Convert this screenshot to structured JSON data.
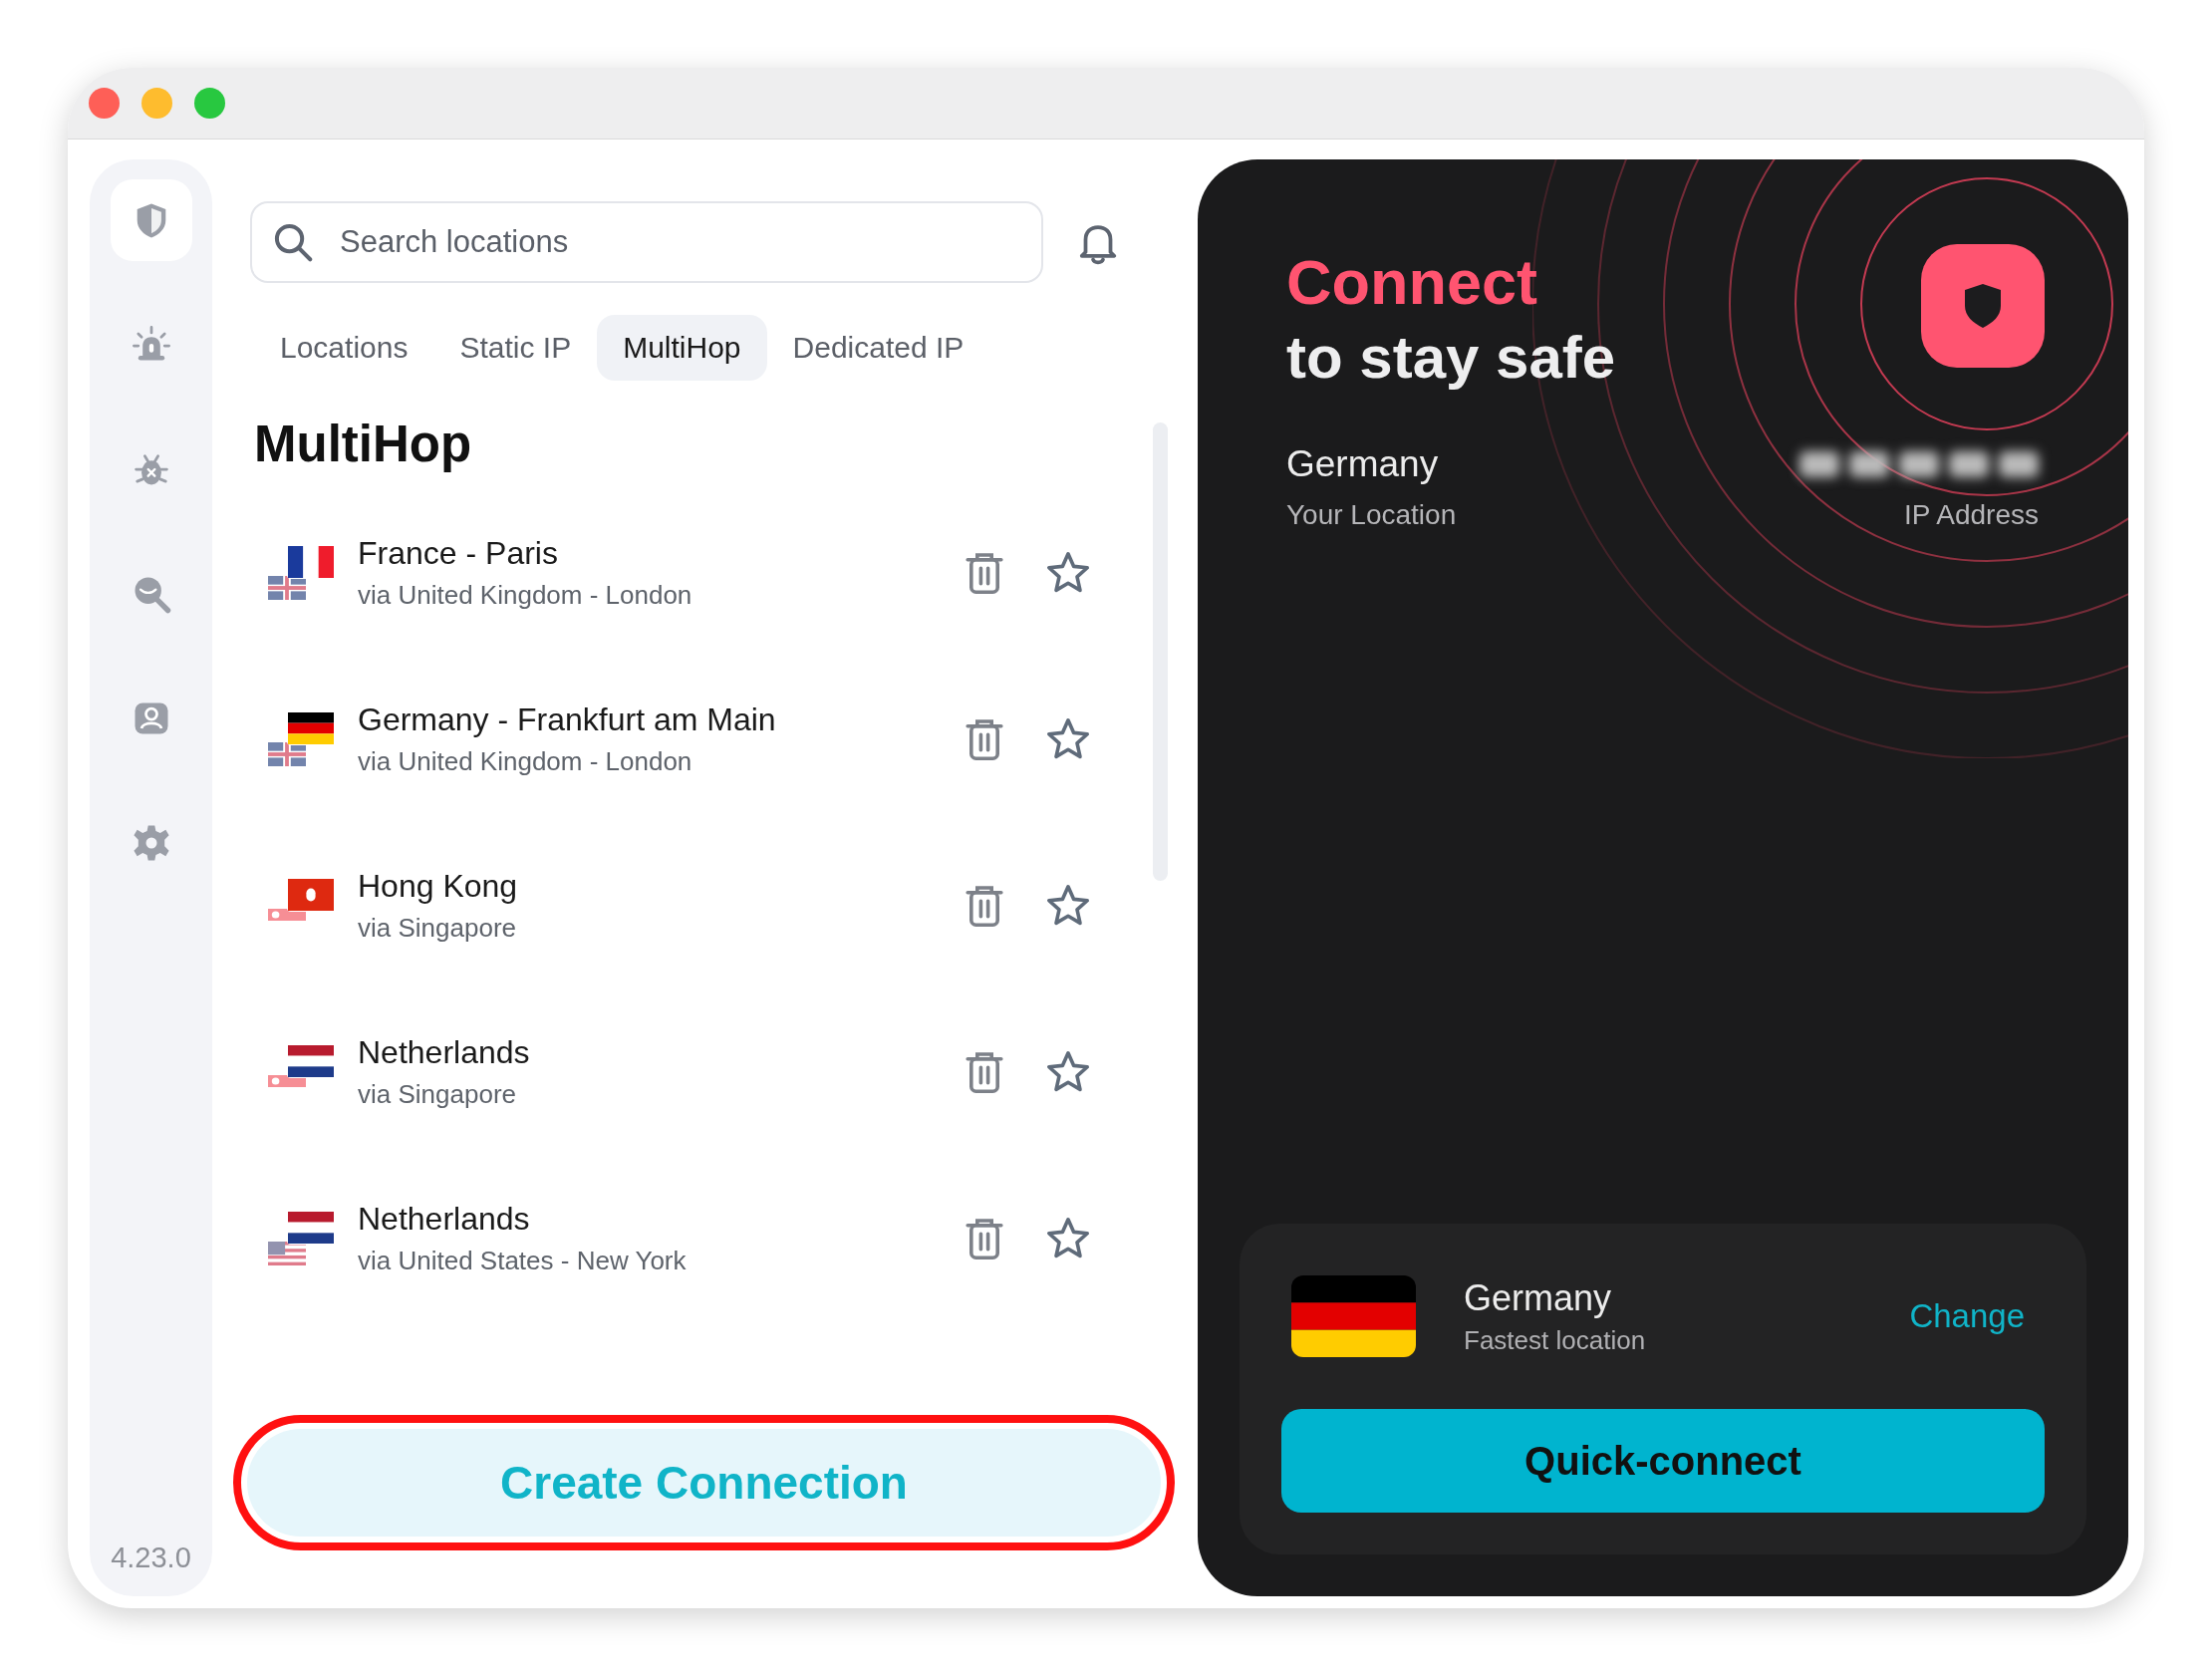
{
  "sidebar": {
    "items": [
      {
        "kind": "shield",
        "selected": true
      },
      {
        "kind": "alarm",
        "selected": false
      },
      {
        "kind": "bug",
        "selected": false
      },
      {
        "kind": "eye-search",
        "selected": false
      },
      {
        "kind": "account",
        "selected": false
      },
      {
        "kind": "settings",
        "selected": false
      }
    ],
    "version": "4.23.0"
  },
  "search": {
    "placeholder": "Search locations"
  },
  "tabs": [
    {
      "label": "Locations",
      "selected": false
    },
    {
      "label": "Static IP",
      "selected": false
    },
    {
      "label": "MultiHop",
      "selected": true
    },
    {
      "label": "Dedicated IP",
      "selected": false
    }
  ],
  "heading": "MultiHop",
  "routes": [
    {
      "name": "France - Paris",
      "via": "via United Kingdom - London",
      "flag": {
        "kind": "fr"
      },
      "via_flag": {
        "kind": "gb"
      }
    },
    {
      "name": "Germany - Frankfurt am Main",
      "via": "via United Kingdom - London",
      "flag": {
        "kind": "de"
      },
      "via_flag": {
        "kind": "gb"
      }
    },
    {
      "name": "Hong Kong",
      "via": "via Singapore",
      "flag": {
        "kind": "hk"
      },
      "via_flag": {
        "kind": "sg"
      }
    },
    {
      "name": "Netherlands",
      "via": "via Singapore",
      "flag": {
        "kind": "nl"
      },
      "via_flag": {
        "kind": "sg"
      }
    },
    {
      "name": "Netherlands",
      "via": "via United States - New York",
      "flag": {
        "kind": "nl"
      },
      "via_flag": {
        "kind": "us"
      }
    }
  ],
  "create_button": "Create Connection",
  "status": {
    "headline": "Connect",
    "subheadline": "to stay safe",
    "location": "Germany",
    "location_label": "Your Location",
    "ip_label": "IP Address"
  },
  "quick_connect": {
    "country": "Germany",
    "note": "Fastest location",
    "flag": {
      "kind": "de"
    },
    "change": "Change",
    "button": "Quick-connect"
  }
}
